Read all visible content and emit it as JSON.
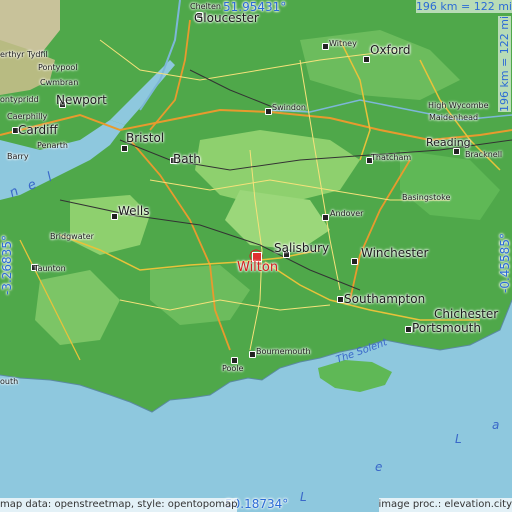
{
  "map": {
    "latitude_north": "51.95431°",
    "latitude_south": "50.18734°",
    "longitude_west": "-3.26835°",
    "longitude_east": "-0.45585°",
    "scale_horizontal": "196 km = 122 mi",
    "scale_vertical": "196 km = 122 mi",
    "highlighted_place": "Wilton",
    "credit_left": "map data: openstreetmap, style: opentopomap",
    "credit_right": "image proc.: elevation.city",
    "colors": {
      "sea": "#8ec8de",
      "lowland": "#4fa84a",
      "upland": "#8ed06e",
      "highland": "#c8c29a",
      "highlight": "#d32020",
      "coord_text": "#2b6bd6"
    },
    "places": {
      "chelt": "Chelten",
      "gloucester": "Gloucester",
      "witney": "Witney",
      "oxford": "Oxford",
      "merthyr": "erthyr Tydfil",
      "pontypool": "Pontypool",
      "cwmbran": "Cwmbran",
      "pontypridd": "ontypridd",
      "newport": "Newport",
      "caerphilly": "Caerphilly",
      "cardiff": "Cardiff",
      "penarth": "Penarth",
      "barry": "Barry",
      "swindon": "Swindon",
      "high_wycombe": "High Wycombe",
      "maidenhead": "Maidenhead",
      "reading": "Reading",
      "bracknell": "Bracknell",
      "bristol": "Bristol",
      "bath": "Bath",
      "thatcham": "Thatcham",
      "basingstoke": "Basingstoke",
      "wells": "Wells",
      "andover": "Andover",
      "bridgwater": "Bridgwater",
      "salisbury": "Salisbury",
      "winchester": "Winchester",
      "taunton": "Taunton",
      "southampton": "Southampton",
      "chichester": "Chichester",
      "portsmouth": "Portsmouth",
      "bournemouth": "Bournemouth",
      "poole": "Poole",
      "louth": "outh"
    },
    "water": {
      "solent": "The Solent",
      "channel_a": "a",
      "channel_l": "L",
      "channel_e": "e",
      "bristol_n": "n",
      "bristol_e": "e",
      "bristol_l": "l"
    }
  }
}
